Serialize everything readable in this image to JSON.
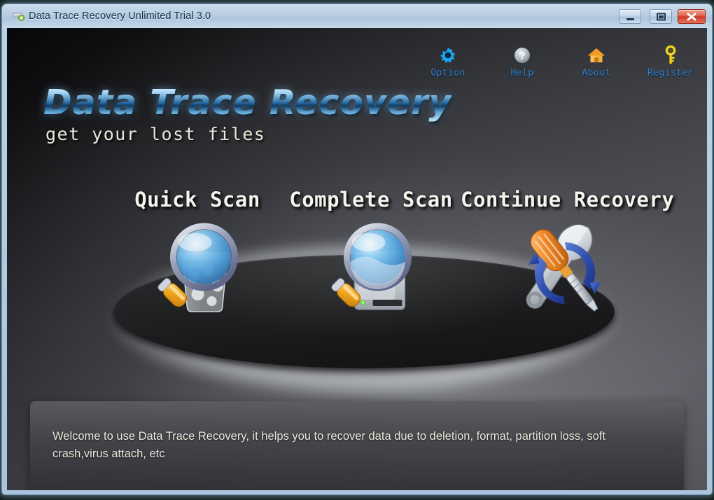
{
  "window": {
    "title": "Data Trace Recovery Unlimited Trial 3.0",
    "app_icon": "drive-add-icon",
    "controls": [
      {
        "name": "minimize-button",
        "icon": "minimize-icon",
        "label": "Minimize"
      },
      {
        "name": "maximize-button",
        "icon": "maximize-icon",
        "label": "Maximize"
      },
      {
        "name": "close-button",
        "icon": "close-icon",
        "label": "Close"
      }
    ]
  },
  "toolbar": {
    "items": [
      {
        "label": "Option",
        "icon": "gear-icon",
        "color": "#18a6f0"
      },
      {
        "label": "Help",
        "icon": "question-mark-icon",
        "color": "#b9c2c8"
      },
      {
        "label": "About",
        "icon": "home-icon",
        "color": "#f0a62c"
      },
      {
        "label": "Register",
        "icon": "key-icon",
        "color": "#f4d61e"
      }
    ],
    "label_color": "#2e84d8"
  },
  "branding": {
    "title": "Data Trace Recovery",
    "tagline": "get your lost files"
  },
  "actions": [
    {
      "label": "Quick Scan",
      "icon": "magnifier-recycle-bin-icon"
    },
    {
      "label": "Complete Scan",
      "icon": "magnifier-hard-drive-icon"
    },
    {
      "label": "Continue Recovery",
      "icon": "screwdriver-wrench-refresh-icon"
    }
  ],
  "welcome": {
    "text": "Welcome to use Data Trace Recovery, it helps you to recover data due to deletion, format, partition loss, soft crash,virus attach, etc"
  }
}
